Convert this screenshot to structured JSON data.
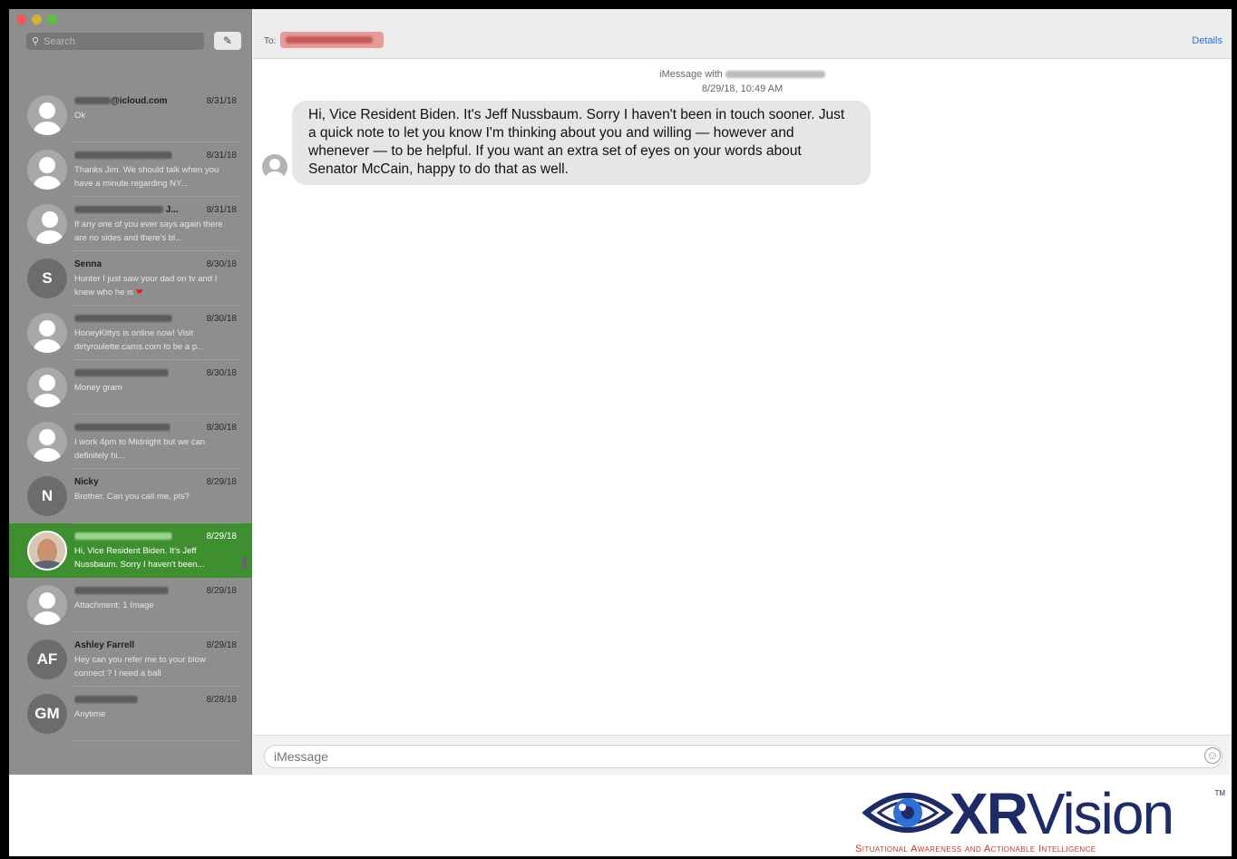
{
  "window": {
    "search_placeholder": "Search",
    "compose_icon": "compose-icon"
  },
  "conversations": [
    {
      "name": "@icloud.com",
      "date": "8/31/18",
      "preview": "Ok",
      "avatar": "person"
    },
    {
      "name": "",
      "date": "8/31/18",
      "preview": "Thanks Jim. We should talk when you have a minute regarding NY...",
      "avatar": "person"
    },
    {
      "name": "J...",
      "date": "8/31/18",
      "preview": "If any one of you ever says again there are no sides and there's bl...",
      "avatar": "group"
    },
    {
      "name": "Senna",
      "date": "8/30/18",
      "preview": "Hunter I just saw your dad on tv and I knew who he is",
      "avatar_initials": "S"
    },
    {
      "name": "",
      "date": "8/30/18",
      "preview": "HoneyKittys is online now! Visit dirtyroulette.cams.com to be a p...",
      "avatar": "person"
    },
    {
      "name": "",
      "date": "8/30/18",
      "preview": "Money gram",
      "avatar": "person"
    },
    {
      "name": "",
      "date": "8/30/18",
      "preview": "I work 4pm to Midnight but we can definitely hi...",
      "avatar": "person"
    },
    {
      "name": "Nicky",
      "date": "8/29/18",
      "preview": "Brother. Can you call me, pls?",
      "avatar_initials": "N"
    },
    {
      "name": "",
      "date": "8/29/18",
      "preview": "Hi, Vice Resident Biden. It's Jeff Nussbaum. Sorry I haven't been...",
      "avatar": "photo",
      "selected": true
    },
    {
      "name": "",
      "date": "8/29/18",
      "preview": "Attachment: 1 Image",
      "avatar": "person"
    },
    {
      "name": "Ashley Farrell",
      "date": "8/29/18",
      "preview": "Hey can you refer me to your blow connect ? I need a ball",
      "avatar_initials": "AF"
    },
    {
      "name": "",
      "date": "8/28/18",
      "preview": "Anytime",
      "avatar_initials": "GM"
    }
  ],
  "header": {
    "to_label": "To:",
    "details_label": "Details"
  },
  "thread": {
    "imessage_with": "iMessage with",
    "timestamp": "8/29/18, 10:49 AM",
    "message": "Hi, Vice Resident Biden.  It's Jeff Nussbaum.  Sorry I haven't been in touch sooner.  Just a quick note to let you know I'm thinking about you and willing — however and whenever — to be helpful.  If you want an extra set of eyes on your words about Senator McCain, happy to do that as well."
  },
  "input": {
    "placeholder": "iMessage"
  },
  "logo": {
    "brand_bold": "XR",
    "brand_light": "Vision",
    "trademark": "TM",
    "tagline": "Situational Awareness and Actionable Intelligence"
  },
  "colors": {
    "selected_row": "#3e8f30",
    "sidebar": "#8e8e8e",
    "details_link": "#2f6fd6",
    "brand_navy": "#1e2b66",
    "tagline_red": "#c0392b"
  }
}
